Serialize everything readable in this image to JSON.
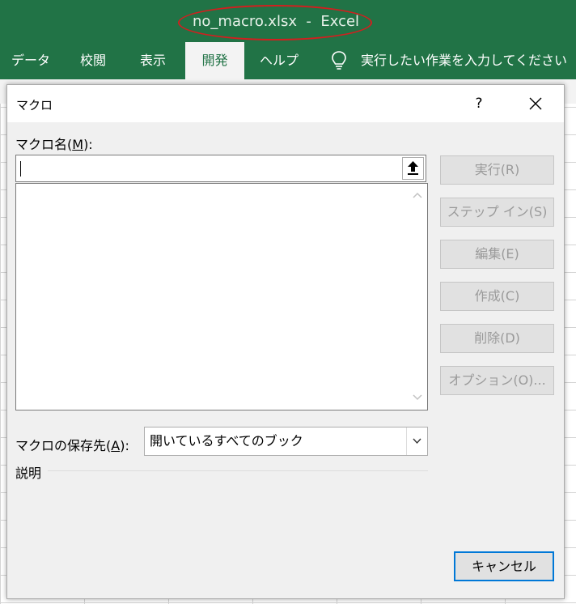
{
  "window": {
    "title": "no_macro.xlsx  -  Excel"
  },
  "ribbon": {
    "tabs": [
      {
        "label": "データ",
        "active": false
      },
      {
        "label": "校閲",
        "active": false
      },
      {
        "label": "表示",
        "active": false
      },
      {
        "label": "開発",
        "active": true
      },
      {
        "label": "ヘルプ",
        "active": false
      }
    ],
    "tell_me": "実行したい作業を入力してください",
    "tell_me_icon": "lightbulb-icon"
  },
  "dialog": {
    "title": "マクロ",
    "help_label": "?",
    "macro_name_label_prefix": "マクロ名(",
    "macro_name_label_key": "M",
    "macro_name_label_suffix": "):",
    "macro_name_value": "",
    "macro_list": [],
    "buttons": {
      "run": "実行(R)",
      "step_in": "ステップ イン(S)",
      "edit": "編集(E)",
      "create": "作成(C)",
      "delete": "削除(D)",
      "options": "オプション(O)..."
    },
    "location_label_prefix": "マクロの保存先(",
    "location_label_key": "A",
    "location_label_suffix": "):",
    "location_value": "開いているすべてのブック",
    "description_label": "説明",
    "cancel": "キャンセル"
  },
  "colors": {
    "excel_green": "#217346",
    "annotation_red": "#d11f1f",
    "focus_blue": "#0078d7"
  }
}
